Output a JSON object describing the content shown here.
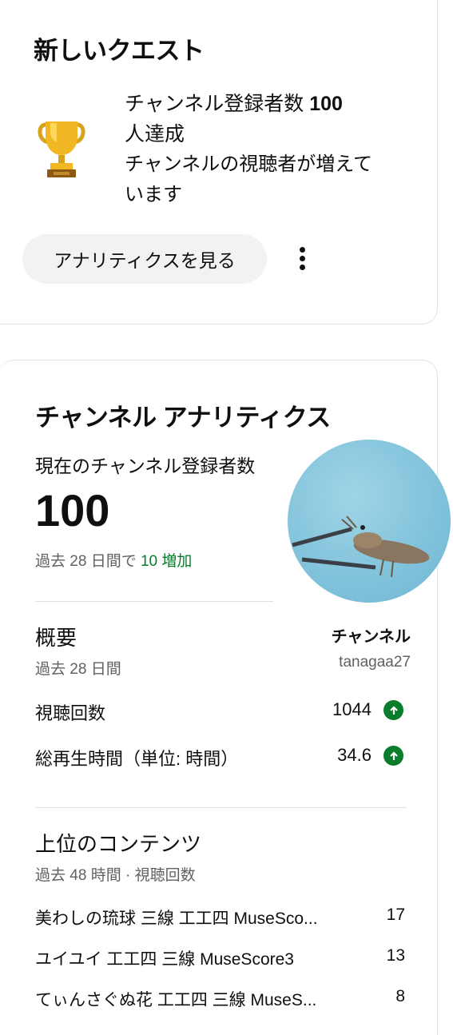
{
  "quest": {
    "title": "新しいクエスト",
    "line1": "チャンネル登録者数",
    "line1_num": "100",
    "line2": "人達成",
    "desc_line1": "チャンネルの視聴者が増えて",
    "desc_line2": "います",
    "button": "アナリティクスを見る",
    "icon": "trophy-icon"
  },
  "analytics": {
    "title": "チャンネル アナリティクス",
    "subs_label": "現在のチャンネル登録者数",
    "subs_count": "100",
    "period_prefix": "過去 28 日間で",
    "period_increase": "10 増加",
    "overview_title": "概要",
    "overview_period": "過去 28 日間",
    "channel_label": "チャンネル",
    "channel_handle": "tanagaa27",
    "stats": [
      {
        "label": "視聴回数",
        "value": "1044"
      },
      {
        "label": "総再生時間（単位: 時間）",
        "value": "34.6"
      }
    ],
    "top_title": "上位のコンテンツ",
    "top_period": "過去 48 時間 · 視聴回数",
    "top_items": [
      {
        "title": "美わしの琉球 三線 工工四 MuseSco...",
        "count": "17"
      },
      {
        "title": "ユイユイ 工工四 三線 MuseScore3",
        "count": "13"
      },
      {
        "title": "てぃんさぐぬ花 工工四 三線 MuseS...",
        "count": "8"
      }
    ],
    "accent_green": "#0a7d2c"
  }
}
